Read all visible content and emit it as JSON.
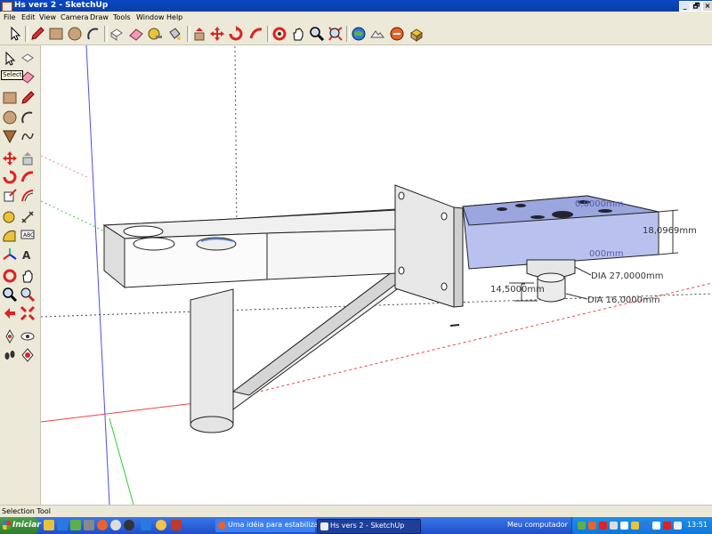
{
  "window": {
    "title": "Hs vers 2 - SketchUp",
    "controls": [
      "_",
      "🗗",
      "×"
    ]
  },
  "menu": [
    "File",
    "Edit",
    "View",
    "Camera",
    "Draw",
    "Tools",
    "Window",
    "Help"
  ],
  "toolbar_icons": [
    "select-icon",
    "pencil-icon",
    "rectangle-icon",
    "circle-icon",
    "arc-icon",
    "eraser-icon",
    "paint-bucket-icon",
    "tape-measure-icon",
    "push-pull-icon",
    "move-icon",
    "rotate-icon",
    "follow-me-icon",
    "orbit-icon",
    "pan-icon",
    "zoom-icon",
    "zoom-extents-icon",
    "google-earth-icon",
    "toggle-terrain-icon",
    "get-models-icon",
    "share-model-icon"
  ],
  "tooltip": "Select",
  "dimensions": {
    "height": "18,0969mm",
    "top_partial": "0,0000mm",
    "side_partial": "000mm",
    "dia_27": "DIA 27,0000mm",
    "depth": "14,5000mm",
    "dia_16": "DIA 16,0000mm"
  },
  "status": "Selection Tool",
  "taskbar": {
    "start": "Iniciar",
    "tasks": [
      "Uma idéia para estabiliza...",
      "Hs vers 2 - SketchUp"
    ],
    "my_computer": "Meu computador",
    "clock": "13:51"
  },
  "colors": {
    "titlebar": "#0b47c7",
    "chrome": "#ece9d8",
    "selection_blue": "#b9c2ef",
    "taskbar": "#245edb"
  }
}
